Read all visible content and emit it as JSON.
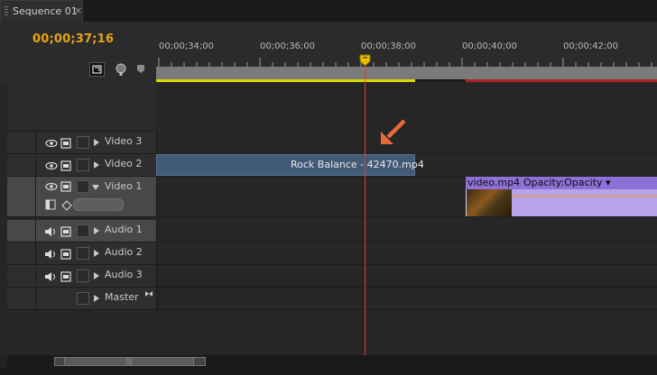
{
  "tab": {
    "label": "Sequence 01",
    "close": "×"
  },
  "header": {
    "timecode": "00;00;37;16"
  },
  "ruler": {
    "labels": [
      "00;00;34;00",
      "00;00;36;00",
      "00;00;38;00",
      "00;00;40;00",
      "00;00;42;00"
    ]
  },
  "tracks": [
    {
      "name": "Video 3",
      "kind": "video"
    },
    {
      "name": "Video 2",
      "kind": "video"
    },
    {
      "name": "Video 1",
      "kind": "video",
      "expanded": true
    },
    {
      "name": "Audio 1",
      "kind": "audio"
    },
    {
      "name": "Audio 2",
      "kind": "audio"
    },
    {
      "name": "Audio 3",
      "kind": "audio"
    },
    {
      "name": "Master",
      "kind": "master"
    }
  ],
  "clips": {
    "rock": {
      "label": "Rock Balance - 42470.mp4"
    },
    "video": {
      "name": "video.mp4",
      "fx": "Opacity:Opacity ▾"
    }
  },
  "colors": {
    "timecode": "#e8a317",
    "playhead": "#e0402a",
    "video_clip": "#405a78",
    "fx_clip": "#b9a3e8"
  },
  "scroll": {
    "grip": "|||"
  }
}
